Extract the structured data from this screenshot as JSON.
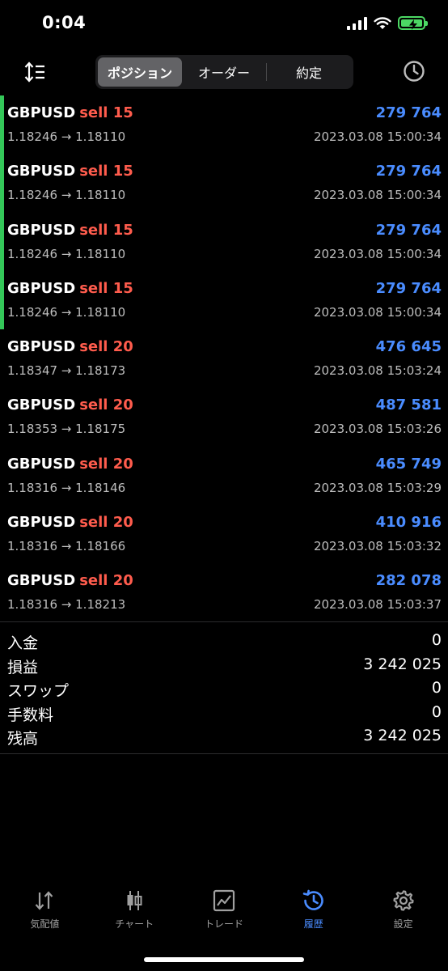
{
  "status": {
    "time": "0:04"
  },
  "tabs": [
    {
      "label": "ポジション",
      "active": true
    },
    {
      "label": "オーダー",
      "active": false
    },
    {
      "label": "約定",
      "active": false
    }
  ],
  "positions": [
    {
      "symbol": "GBPUSD",
      "side": "sell 15",
      "pnl": "279 764",
      "prices": "1.18246 → 1.18110",
      "time": "2023.03.08 15:00:34",
      "open": true
    },
    {
      "symbol": "GBPUSD",
      "side": "sell 15",
      "pnl": "279 764",
      "prices": "1.18246 → 1.18110",
      "time": "2023.03.08 15:00:34",
      "open": true
    },
    {
      "symbol": "GBPUSD",
      "side": "sell 15",
      "pnl": "279 764",
      "prices": "1.18246 → 1.18110",
      "time": "2023.03.08 15:00:34",
      "open": true
    },
    {
      "symbol": "GBPUSD",
      "side": "sell 15",
      "pnl": "279 764",
      "prices": "1.18246 → 1.18110",
      "time": "2023.03.08 15:00:34",
      "open": true
    },
    {
      "symbol": "GBPUSD",
      "side": "sell 20",
      "pnl": "476 645",
      "prices": "1.18347 → 1.18173",
      "time": "2023.03.08 15:03:24",
      "open": false
    },
    {
      "symbol": "GBPUSD",
      "side": "sell 20",
      "pnl": "487 581",
      "prices": "1.18353 → 1.18175",
      "time": "2023.03.08 15:03:26",
      "open": false
    },
    {
      "symbol": "GBPUSD",
      "side": "sell 20",
      "pnl": "465 749",
      "prices": "1.18316 → 1.18146",
      "time": "2023.03.08 15:03:29",
      "open": false
    },
    {
      "symbol": "GBPUSD",
      "side": "sell 20",
      "pnl": "410 916",
      "prices": "1.18316 → 1.18166",
      "time": "2023.03.08 15:03:32",
      "open": false
    },
    {
      "symbol": "GBPUSD",
      "side": "sell 20",
      "pnl": "282 078",
      "prices": "1.18316 → 1.18213",
      "time": "2023.03.08 15:03:37",
      "open": false
    }
  ],
  "summary": [
    {
      "label": "入金",
      "value": "0"
    },
    {
      "label": "損益",
      "value": "3 242 025"
    },
    {
      "label": "スワップ",
      "value": "0"
    },
    {
      "label": "手数料",
      "value": "0"
    },
    {
      "label": "残高",
      "value": "3 242 025"
    }
  ],
  "bottom_tabs": [
    {
      "label": "気配値",
      "icon": "quotes-arrows-icon",
      "active": false
    },
    {
      "label": "チャート",
      "icon": "candlestick-chart-icon",
      "active": false
    },
    {
      "label": "トレード",
      "icon": "trade-line-chart-icon",
      "active": false
    },
    {
      "label": "履歴",
      "icon": "history-clock-icon",
      "active": true
    },
    {
      "label": "設定",
      "icon": "settings-gear-icon",
      "active": false
    }
  ],
  "colors": {
    "background": "#000000",
    "profit_blue": "#4a8cff",
    "sell_red": "#ff5c4d",
    "open_marker_green": "#34c759",
    "active_segment": "#636366"
  }
}
